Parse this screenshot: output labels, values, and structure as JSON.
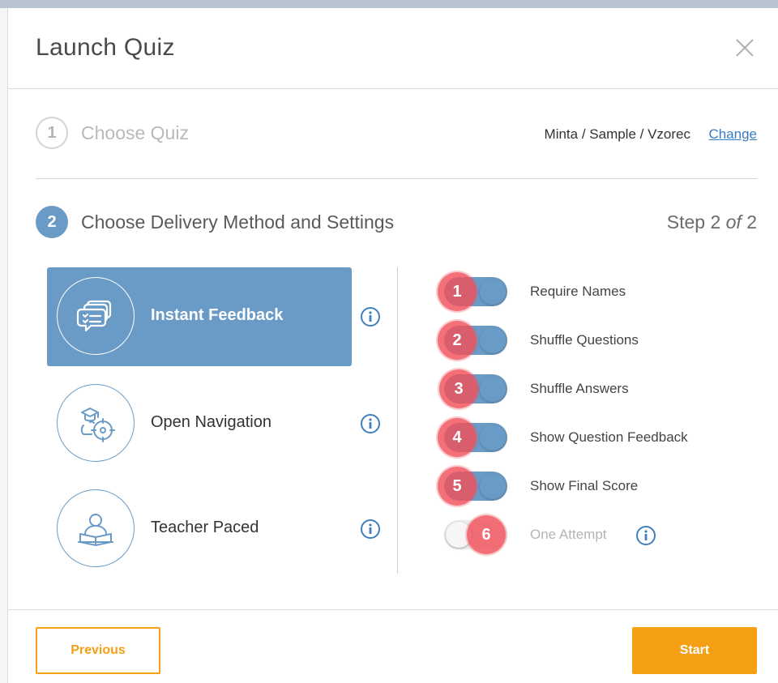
{
  "dialog": {
    "title": "Launch Quiz"
  },
  "step1": {
    "number": "1",
    "label": "Choose Quiz",
    "quiz_name": "Minta / Sample / Vzorec",
    "change_link": "Change"
  },
  "step2": {
    "number": "2",
    "label": "Choose Delivery Method and Settings",
    "counter_prefix": "Step 2",
    "counter_of": "of",
    "counter_total": "2"
  },
  "methods": [
    {
      "label": "Instant Feedback",
      "icon": "chat-list-icon",
      "selected": true
    },
    {
      "label": "Open Navigation",
      "icon": "navigation-compass-icon",
      "selected": false
    },
    {
      "label": "Teacher Paced",
      "icon": "teacher-book-icon",
      "selected": false
    }
  ],
  "settings": [
    {
      "badge": "1",
      "label": "Require Names",
      "enabled": true,
      "disabled": false
    },
    {
      "badge": "2",
      "label": "Shuffle Questions",
      "enabled": true,
      "disabled": false
    },
    {
      "badge": "3",
      "label": "Shuffle Answers",
      "enabled": true,
      "disabled": false
    },
    {
      "badge": "4",
      "label": "Show Question Feedback",
      "enabled": true,
      "disabled": false
    },
    {
      "badge": "5",
      "label": "Show Final Score",
      "enabled": true,
      "disabled": false
    },
    {
      "badge": "6",
      "label": "One Attempt",
      "enabled": false,
      "disabled": true
    }
  ],
  "footer": {
    "previous_label": "Previous",
    "start_label": "Start"
  },
  "colors": {
    "primary_blue": "#6a9bc6",
    "accent_orange": "#f49f14",
    "badge_red": "#f0505a"
  }
}
